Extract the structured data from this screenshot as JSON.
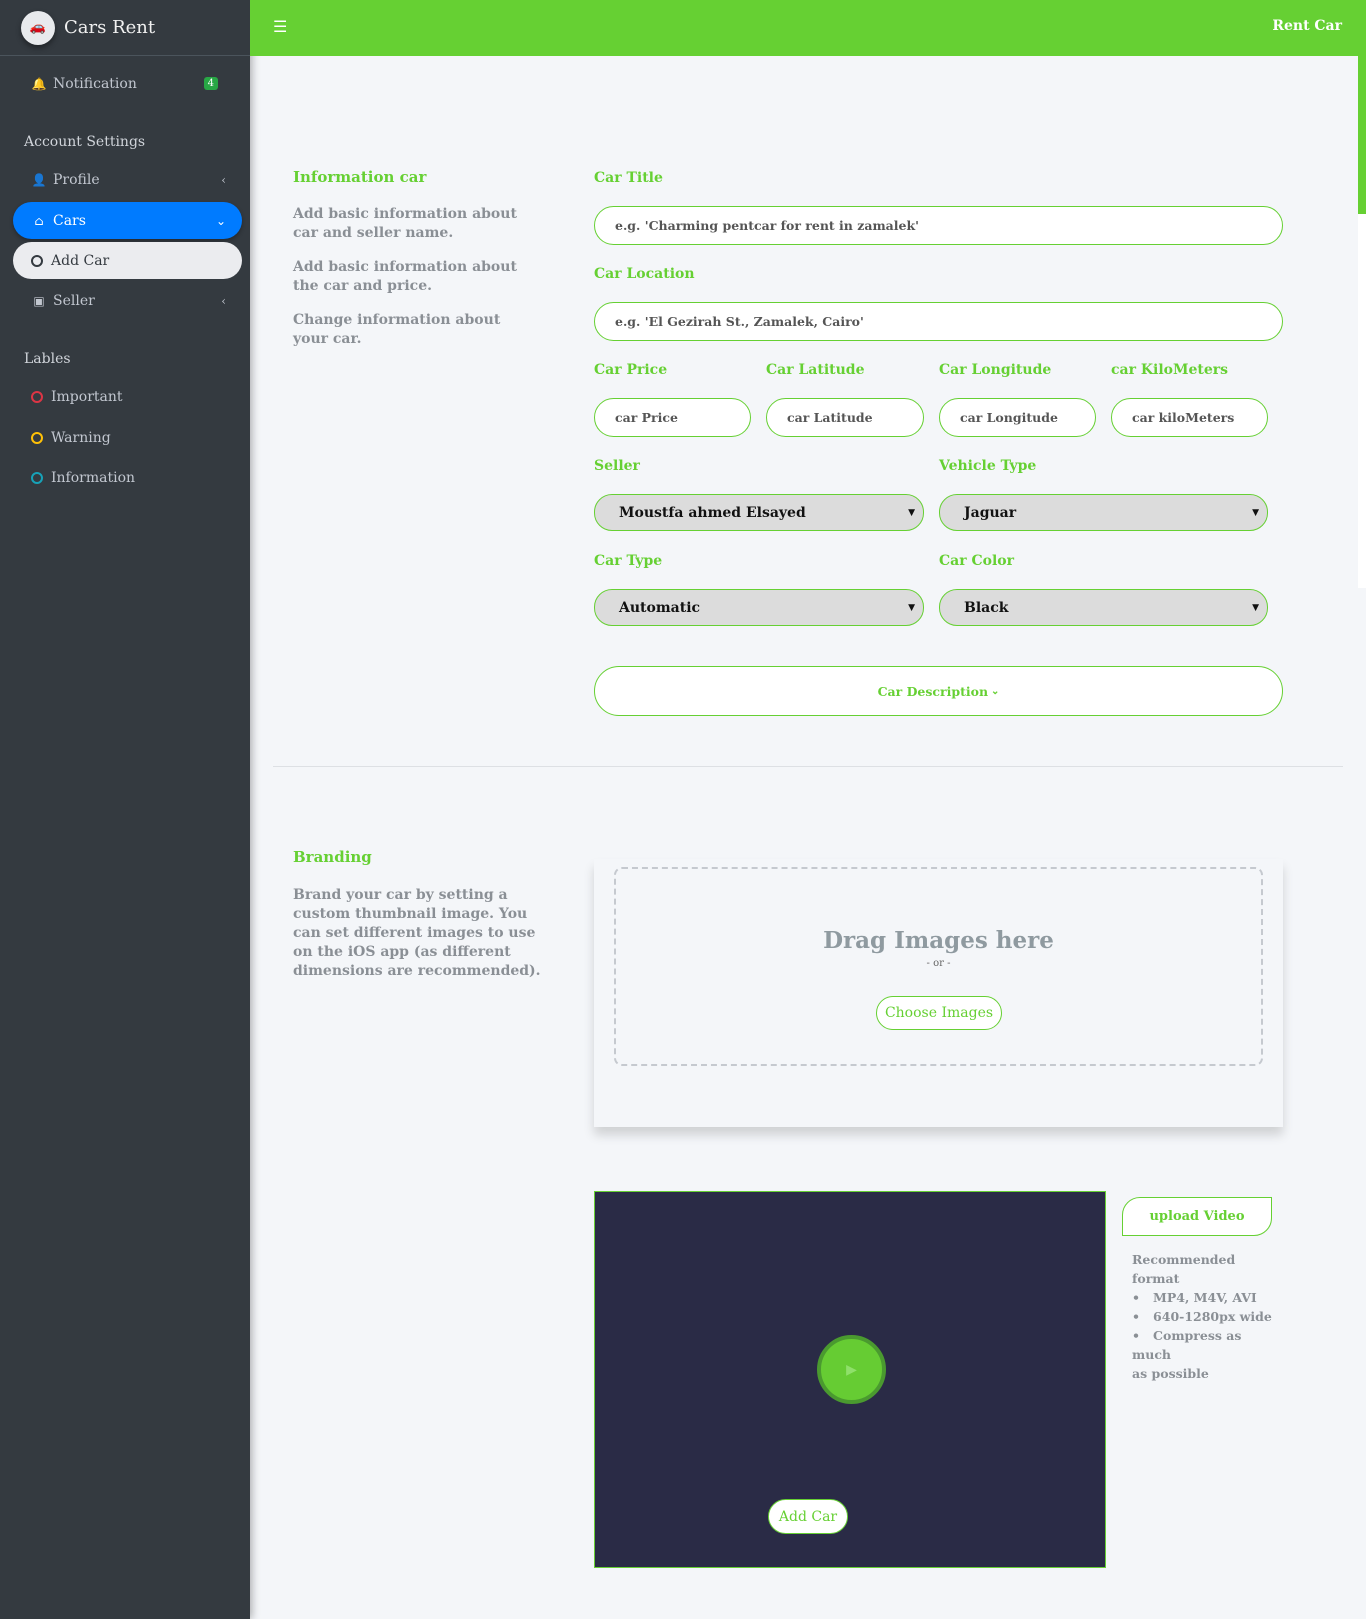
{
  "brand": "Cars Rent",
  "topbar": {
    "title": "Rent Car"
  },
  "sidebar": {
    "notification": "Notification",
    "notification_count": "4",
    "account_header": "Account Settings",
    "profile": "Profile",
    "cars": "Cars",
    "add_car": "Add Car",
    "seller": "Seller",
    "labels_header": "Lables",
    "labels": [
      {
        "label": "Important",
        "color": "#dc3545"
      },
      {
        "label": "Warning",
        "color": "#ffc107"
      },
      {
        "label": "Information",
        "color": "#17a2b8"
      }
    ]
  },
  "info": {
    "title": "Information car",
    "desc": [
      "Add basic information about car and seller name.",
      "Add basic information about the car and price.",
      "Change information about your car."
    ]
  },
  "form": {
    "title_label": "Car Title",
    "title_ph": "e.g. 'Charming  pentcar for rent in zamalek'",
    "location_label": "Car Location",
    "location_ph": "e.g. 'El Gezirah St., Zamalek, Cairo'",
    "price_label": "Car Price",
    "price_ph": "car Price",
    "lat_label": "Car Latitude",
    "lat_ph": "car Latitude",
    "lng_label": "Car Longitude",
    "lng_ph": "car Longitude",
    "km_label": "car KiloMeters",
    "km_ph": "car kiloMeters",
    "seller_label": "Seller",
    "seller_value": "Moustfa ahmed Elsayed",
    "vtype_label": "Vehicle Type",
    "vtype_value": "Jaguar",
    "ctype_label": "Car Type",
    "ctype_value": "Automatic",
    "color_label": "Car Color",
    "color_value": "Black",
    "description": "Car Description"
  },
  "branding": {
    "title": "Branding",
    "desc": "Brand your car by setting a custom thumbnail image. You can set different images to use on the iOS app (as different dimensions are recommended).",
    "drag": "Drag Images here",
    "or": "- or -",
    "choose": "Choose Images"
  },
  "video": {
    "upload": "upload Video",
    "rec_title": "Recommended format",
    "rec": [
      "MP4, M4V, AVI",
      "640-1280px wide",
      "Compress as much"
    ],
    "rec_tail": "as possible"
  },
  "submit": "Add Car"
}
